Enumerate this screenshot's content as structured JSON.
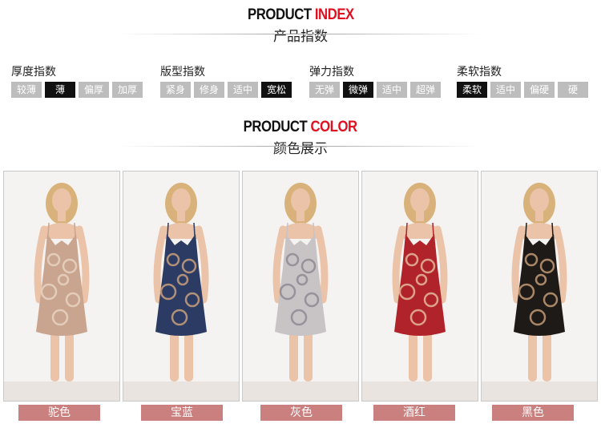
{
  "index_heading": {
    "en_main": "PRODUCT",
    "en_accent": "INDEX",
    "cn": "产品指数"
  },
  "groups": [
    {
      "title": "厚度指数",
      "tags": [
        "较薄",
        "薄",
        "偏厚",
        "加厚"
      ],
      "active": 1
    },
    {
      "title": "版型指数",
      "tags": [
        "紧身",
        "修身",
        "适中",
        "宽松"
      ],
      "active": 3
    },
    {
      "title": "弹力指数",
      "tags": [
        "无弹",
        "微弹",
        "适中",
        "超弹"
      ],
      "active": 1
    },
    {
      "title": "柔软指数",
      "tags": [
        "柔软",
        "适中",
        "偏硬",
        "硬"
      ],
      "active": 0
    }
  ],
  "color_heading": {
    "en_main": "PRODUCT",
    "en_accent": "COLOR",
    "cn": "颜色展示"
  },
  "colors": [
    {
      "name": "驼色",
      "dress": "#c9a58f",
      "pattern": "#e8d2c2"
    },
    {
      "name": "宝蓝",
      "dress": "#2c3b63",
      "pattern": "#c9a07a"
    },
    {
      "name": "灰色",
      "dress": "#c8c4c6",
      "pattern": "#8d8a92"
    },
    {
      "name": "酒红",
      "dress": "#b0232a",
      "pattern": "#e3b79a"
    },
    {
      "name": "黑色",
      "dress": "#1e1a18",
      "pattern": "#c29a74"
    }
  ],
  "style_colors": {
    "active_tag": "#111111",
    "inactive_tag": "#bdbdbd",
    "label_bg": "#c9807f",
    "accent": "#e01020"
  }
}
